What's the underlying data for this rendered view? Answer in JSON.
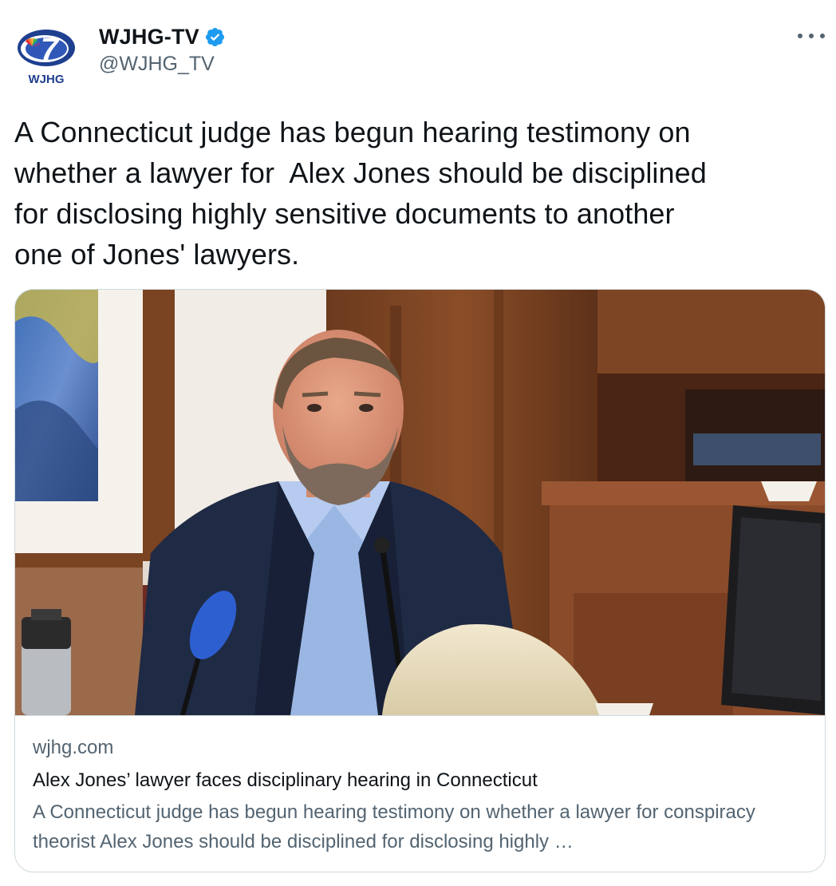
{
  "author": {
    "display_name": "WJHG-TV",
    "handle": "@WJHG_TV",
    "avatar_text": "WJHG",
    "avatar_number": "7"
  },
  "tweet": {
    "text": "A Connecticut judge has begun hearing testimony on\nwhether a lawyer for  Alex Jones should be disciplined\nfor disclosing highly sensitive documents to another\none of Jones' lawyers."
  },
  "card": {
    "domain": "wjhg.com",
    "title": "Alex Jones’ lawyer faces disciplinary hearing in Connecticut",
    "description": "A Connecticut judge has begun hearing testimony on whether a lawyer for conspiracy theorist Alex Jones should be disciplined for disclosing highly …"
  },
  "colors": {
    "verified_blue": "#1d9bf0",
    "text_primary": "#0f1419",
    "text_secondary": "#536471",
    "border": "#cfd9de",
    "brand_blue": "#1f3f8f"
  },
  "icons": {
    "verified": "verified-badge-icon",
    "more": "more-horizontal-icon"
  }
}
